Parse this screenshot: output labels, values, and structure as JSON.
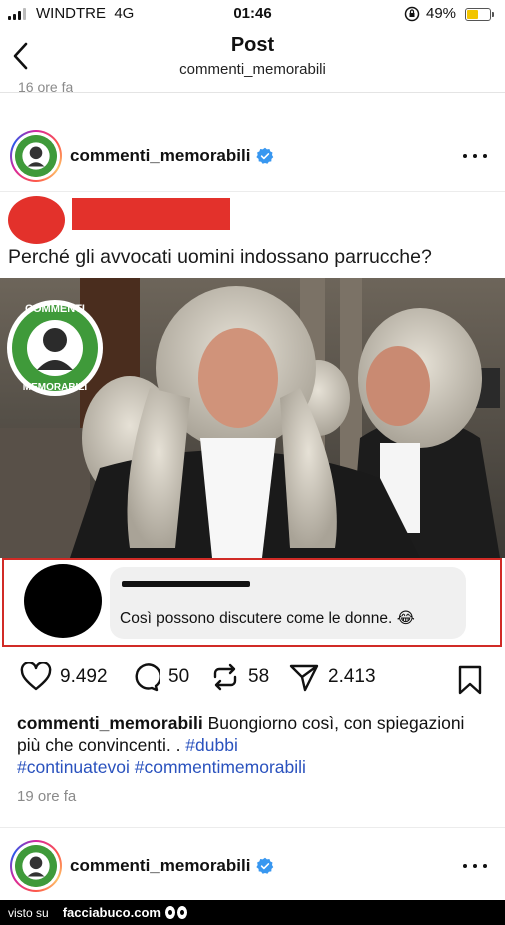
{
  "status_bar": {
    "carrier": "WINDTRE",
    "network": "4G",
    "time": "01:46",
    "battery_percent": "49%",
    "battery_level": 0.49,
    "battery_color": "#f2c500"
  },
  "header": {
    "title": "Post",
    "subtitle": "commenti_memorabili",
    "back_icon": "chevron-left-icon",
    "previous_post_time": "16 ore fa"
  },
  "post": {
    "username": "commenti_memorabili",
    "verified_icon": "verified-badge-icon",
    "more_icon": "more-horizontal-icon",
    "meme": {
      "question": "Perché gli avvocati uomini indossano parrucche?",
      "logo_text_top": "COMMENTI",
      "logo_text_bottom": "MEMORABILI",
      "comment_text": "Così possono discutere come le donne. 😂",
      "highlight_color": "#d12b26",
      "redaction_color": "#e3312b"
    },
    "actions": {
      "likes": "9.492",
      "comments": "50",
      "reposts": "58",
      "shares": "2.413"
    },
    "caption": {
      "username": "commenti_memorabili",
      "text": " Buongiorno così, con spiegazioni più che convincenti. . ",
      "hashtags": [
        "#dubbi",
        "#continuatevoi",
        "#commentimemorabili"
      ]
    },
    "time": "19 ore fa"
  },
  "next_post": {
    "username": "commenti_memorabili"
  },
  "watermark": {
    "prefix": "visto su",
    "site": "facciabuco.com"
  },
  "colors": {
    "hashtag": "#2a52be",
    "verified": "#3897f0",
    "brand_green": "#3f9a3a"
  }
}
